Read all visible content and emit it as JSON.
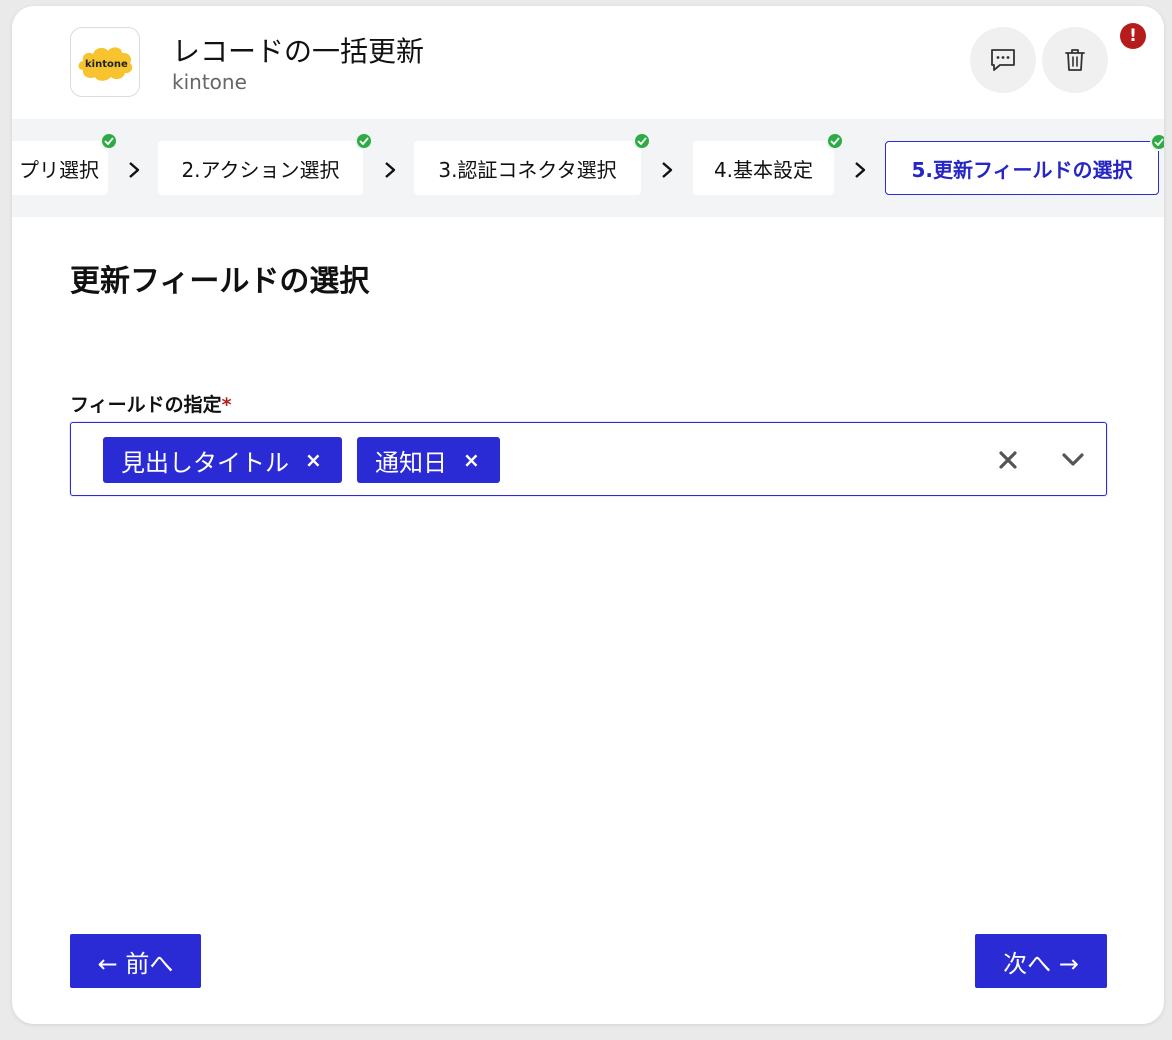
{
  "header": {
    "title": "レコードの一括更新",
    "subtitle": "kintone",
    "logo_text": "kintone",
    "alert_badge": "!"
  },
  "icons": {
    "comment": "comment-icon",
    "trash": "trash-icon",
    "check": "check-icon",
    "chevron_right": "chevron-right-icon",
    "clear": "clear-icon",
    "chevron_down": "chevron-down-icon"
  },
  "steps": [
    {
      "label": "プリ選択",
      "completed": true,
      "active": false
    },
    {
      "label": "2.アクション選択",
      "completed": true,
      "active": false
    },
    {
      "label": "3.認証コネクタ選択",
      "completed": true,
      "active": false
    },
    {
      "label": "4.基本設定",
      "completed": true,
      "active": false
    },
    {
      "label": "5.更新フィールドの選択",
      "completed": true,
      "active": true
    }
  ],
  "main": {
    "section_title": "更新フィールドの選択",
    "field_label": "フィールドの指定",
    "required_mark": "*",
    "selected_fields": [
      "見出しタイトル",
      "通知日"
    ],
    "chip_remove": "×"
  },
  "footer": {
    "prev_label": "← 前へ",
    "next_label": "次へ →"
  },
  "colors": {
    "primary": "#2b2bd6",
    "check": "#2dac45",
    "alert": "#b71c1c",
    "logo": "#f7c32e"
  }
}
